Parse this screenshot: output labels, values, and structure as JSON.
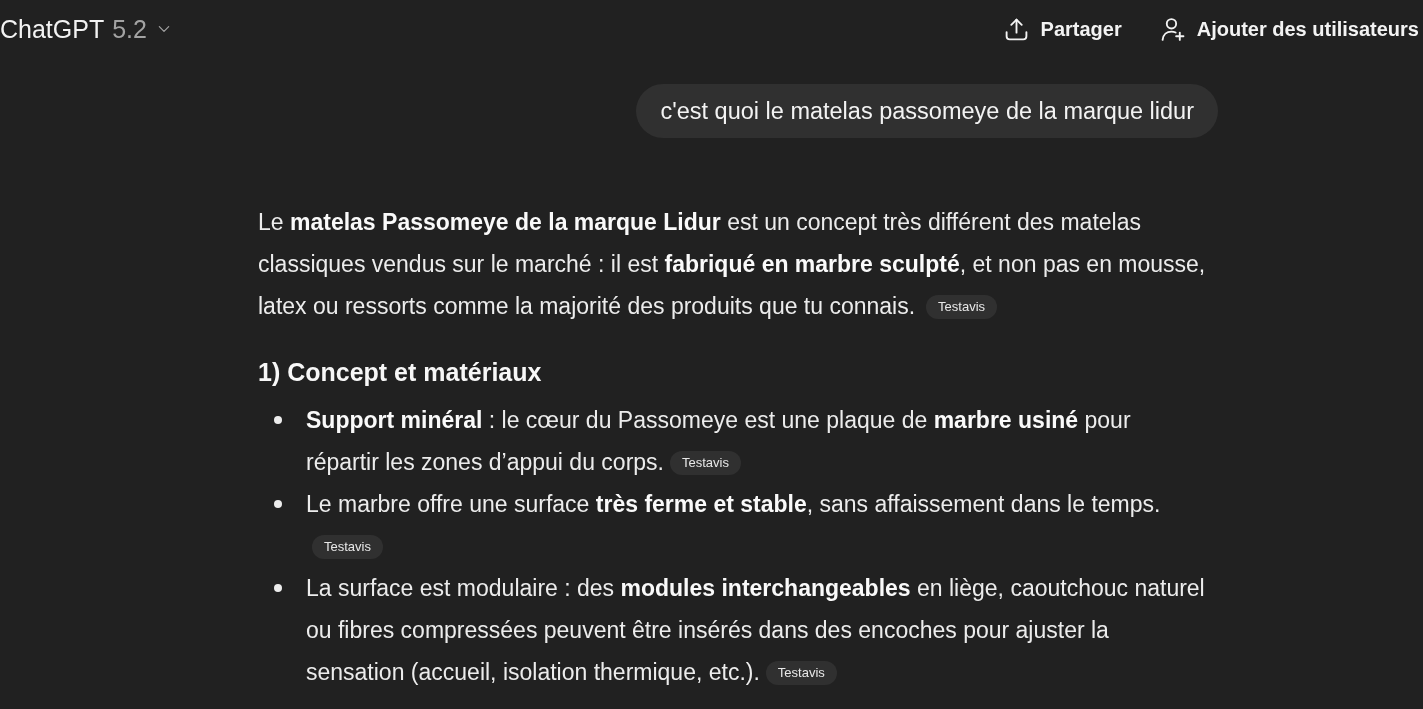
{
  "header": {
    "title": "ChatGPT",
    "version": "5.2",
    "actions": [
      {
        "kind": "share",
        "label": "Partager"
      },
      {
        "kind": "add_users",
        "label": "Ajouter des utilisateurs"
      }
    ]
  },
  "messages": [
    {
      "kind": "user",
      "text": "c'est quoi le matelas passomeye de la marque lidur"
    },
    {
      "kind": "assistant",
      "blocks": [
        {
          "kind": "paragraph",
          "text": "Le **matelas Passomeye de la marque Lidur** est un concept très différent des matelas classiques vendus sur le marché : il est **fabriqué en marbre sculpté**, et non pas en mousse, latex ou ressorts comme la majorité des produits que tu connais.",
          "source": "Testavis"
        },
        {
          "kind": "heading",
          "text": "1) Concept et matériaux"
        },
        {
          "kind": "list",
          "items": [
            {
              "text": "**Support minéral** : le cœur du Passomeye est une plaque de **marbre usiné** pour répartir les zones d’appui du corps.",
              "source": "Testavis"
            },
            {
              "text": "Le marbre offre une surface **très ferme et stable**, sans affaissement dans le temps.",
              "source": "Testavis"
            },
            {
              "text": "La surface est modulaire : des **modules interchangeables** en liège, caoutchouc naturel ou fibres compressées peuvent être insérés dans des encoches pour ajuster la sensation (accueil, isolation thermique, etc.).",
              "source": "Testavis"
            }
          ]
        }
      ]
    }
  ]
}
